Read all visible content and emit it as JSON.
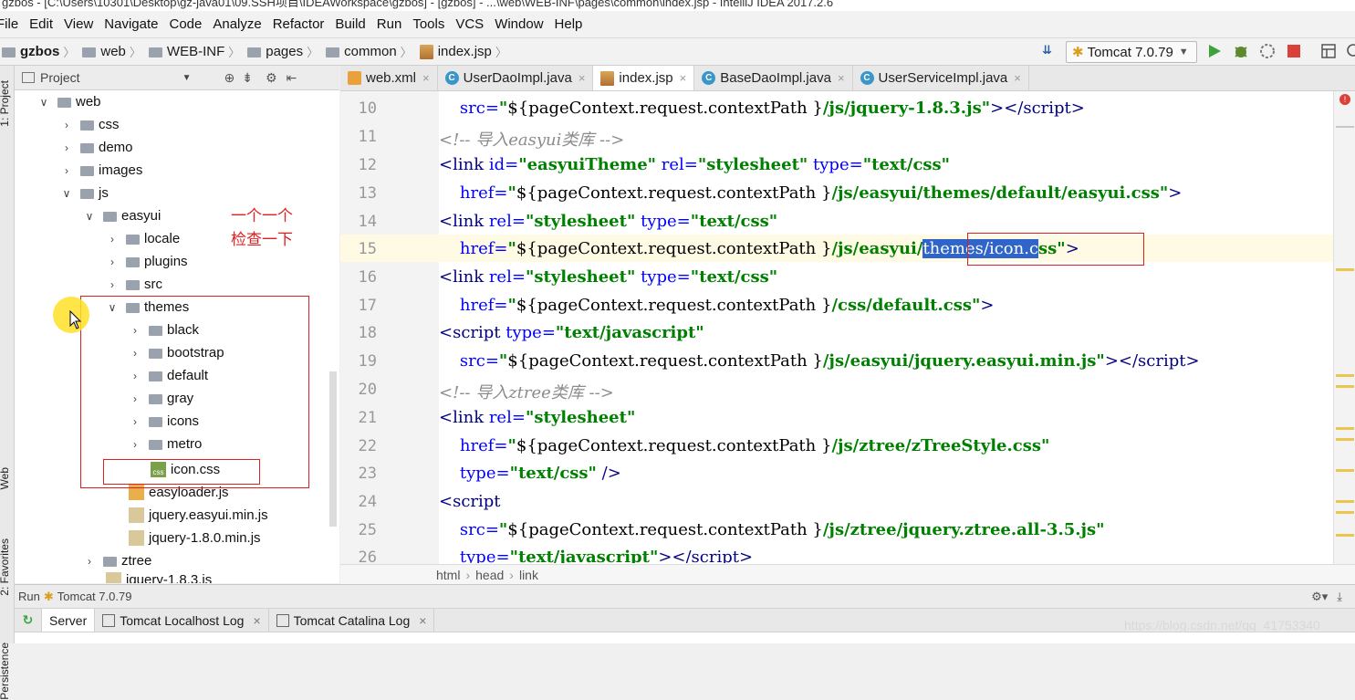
{
  "window": {
    "title": "gzbos - [C:\\Users\\10301\\Desktop\\gz-java01\\09.SSH项目\\IDEAWorkspace\\gzbos] - [gzbos] - ...\\web\\WEB-INF\\pages\\common\\index.jsp - IntelliJ IDEA 2017.2.6"
  },
  "menu": [
    "File",
    "Edit",
    "View",
    "Navigate",
    "Code",
    "Analyze",
    "Refactor",
    "Build",
    "Run",
    "Tools",
    "VCS",
    "Window",
    "Help"
  ],
  "navbar": {
    "crumbs": [
      "gzbos",
      "web",
      "WEB-INF",
      "pages",
      "common",
      "index.jsp"
    ],
    "run_config": "Tomcat 7.0.79"
  },
  "sidebar": {
    "left_labels": [
      "1: Project",
      "Web",
      "2: Favorites",
      "Persistence"
    ]
  },
  "project": {
    "header": "Project",
    "tree": [
      {
        "label": "web",
        "expanded": true,
        "kind": "folder"
      },
      {
        "label": "css",
        "expanded": false,
        "kind": "folder"
      },
      {
        "label": "demo",
        "expanded": false,
        "kind": "folder"
      },
      {
        "label": "images",
        "expanded": false,
        "kind": "folder"
      },
      {
        "label": "js",
        "expanded": true,
        "kind": "folder"
      },
      {
        "label": "easyui",
        "expanded": true,
        "kind": "folder"
      },
      {
        "label": "locale",
        "expanded": false,
        "kind": "folder"
      },
      {
        "label": "plugins",
        "expanded": false,
        "kind": "folder"
      },
      {
        "label": "src",
        "expanded": false,
        "kind": "folder"
      },
      {
        "label": "themes",
        "expanded": true,
        "kind": "folder"
      },
      {
        "label": "black",
        "expanded": false,
        "kind": "folder"
      },
      {
        "label": "bootstrap",
        "expanded": false,
        "kind": "folder"
      },
      {
        "label": "default",
        "expanded": false,
        "kind": "folder"
      },
      {
        "label": "gray",
        "expanded": false,
        "kind": "folder"
      },
      {
        "label": "icons",
        "expanded": false,
        "kind": "folder"
      },
      {
        "label": "metro",
        "expanded": false,
        "kind": "folder"
      },
      {
        "label": "icon.css",
        "kind": "css"
      },
      {
        "label": "easyloader.js",
        "kind": "js"
      },
      {
        "label": "jquery.easyui.min.js",
        "kind": "js"
      },
      {
        "label": "jquery-1.8.0.min.js",
        "kind": "js"
      },
      {
        "label": "ztree",
        "expanded": false,
        "kind": "folder"
      },
      {
        "label": "jquery-1.8.3.js",
        "kind": "js"
      }
    ],
    "annotation": [
      "一个一个",
      "检查一下"
    ]
  },
  "tabs": [
    {
      "label": "web.xml",
      "icon": "xml",
      "active": false
    },
    {
      "label": "UserDaoImpl.java",
      "icon": "class",
      "active": false
    },
    {
      "label": "index.jsp",
      "icon": "jsp",
      "active": true
    },
    {
      "label": "BaseDaoImpl.java",
      "icon": "class",
      "active": false
    },
    {
      "label": "UserServiceImpl.java",
      "icon": "class",
      "active": false
    }
  ],
  "editor": {
    "line_numbers": [
      "10",
      "11",
      "12",
      "13",
      "14",
      "15",
      "16",
      "17",
      "18",
      "19",
      "20",
      "21",
      "22",
      "23",
      "24",
      "25",
      "26"
    ],
    "current_line": "15",
    "selected_text": "themes/icon.c"
  },
  "code_breadcrumb": [
    "html",
    "head",
    "link"
  ],
  "run": {
    "header_label": "Run",
    "config": "Tomcat 7.0.79",
    "tabs": [
      "Server",
      "Tomcat Localhost Log",
      "Tomcat Catalina Log"
    ]
  },
  "watermark": "https://blog.csdn.net/qq_41753340",
  "colors": {
    "annotation": "#e02020",
    "selection": "#2f65ca",
    "current_line": "#fffae3",
    "string": "#008000",
    "tag": "#000080",
    "attr": "#0000ff"
  }
}
